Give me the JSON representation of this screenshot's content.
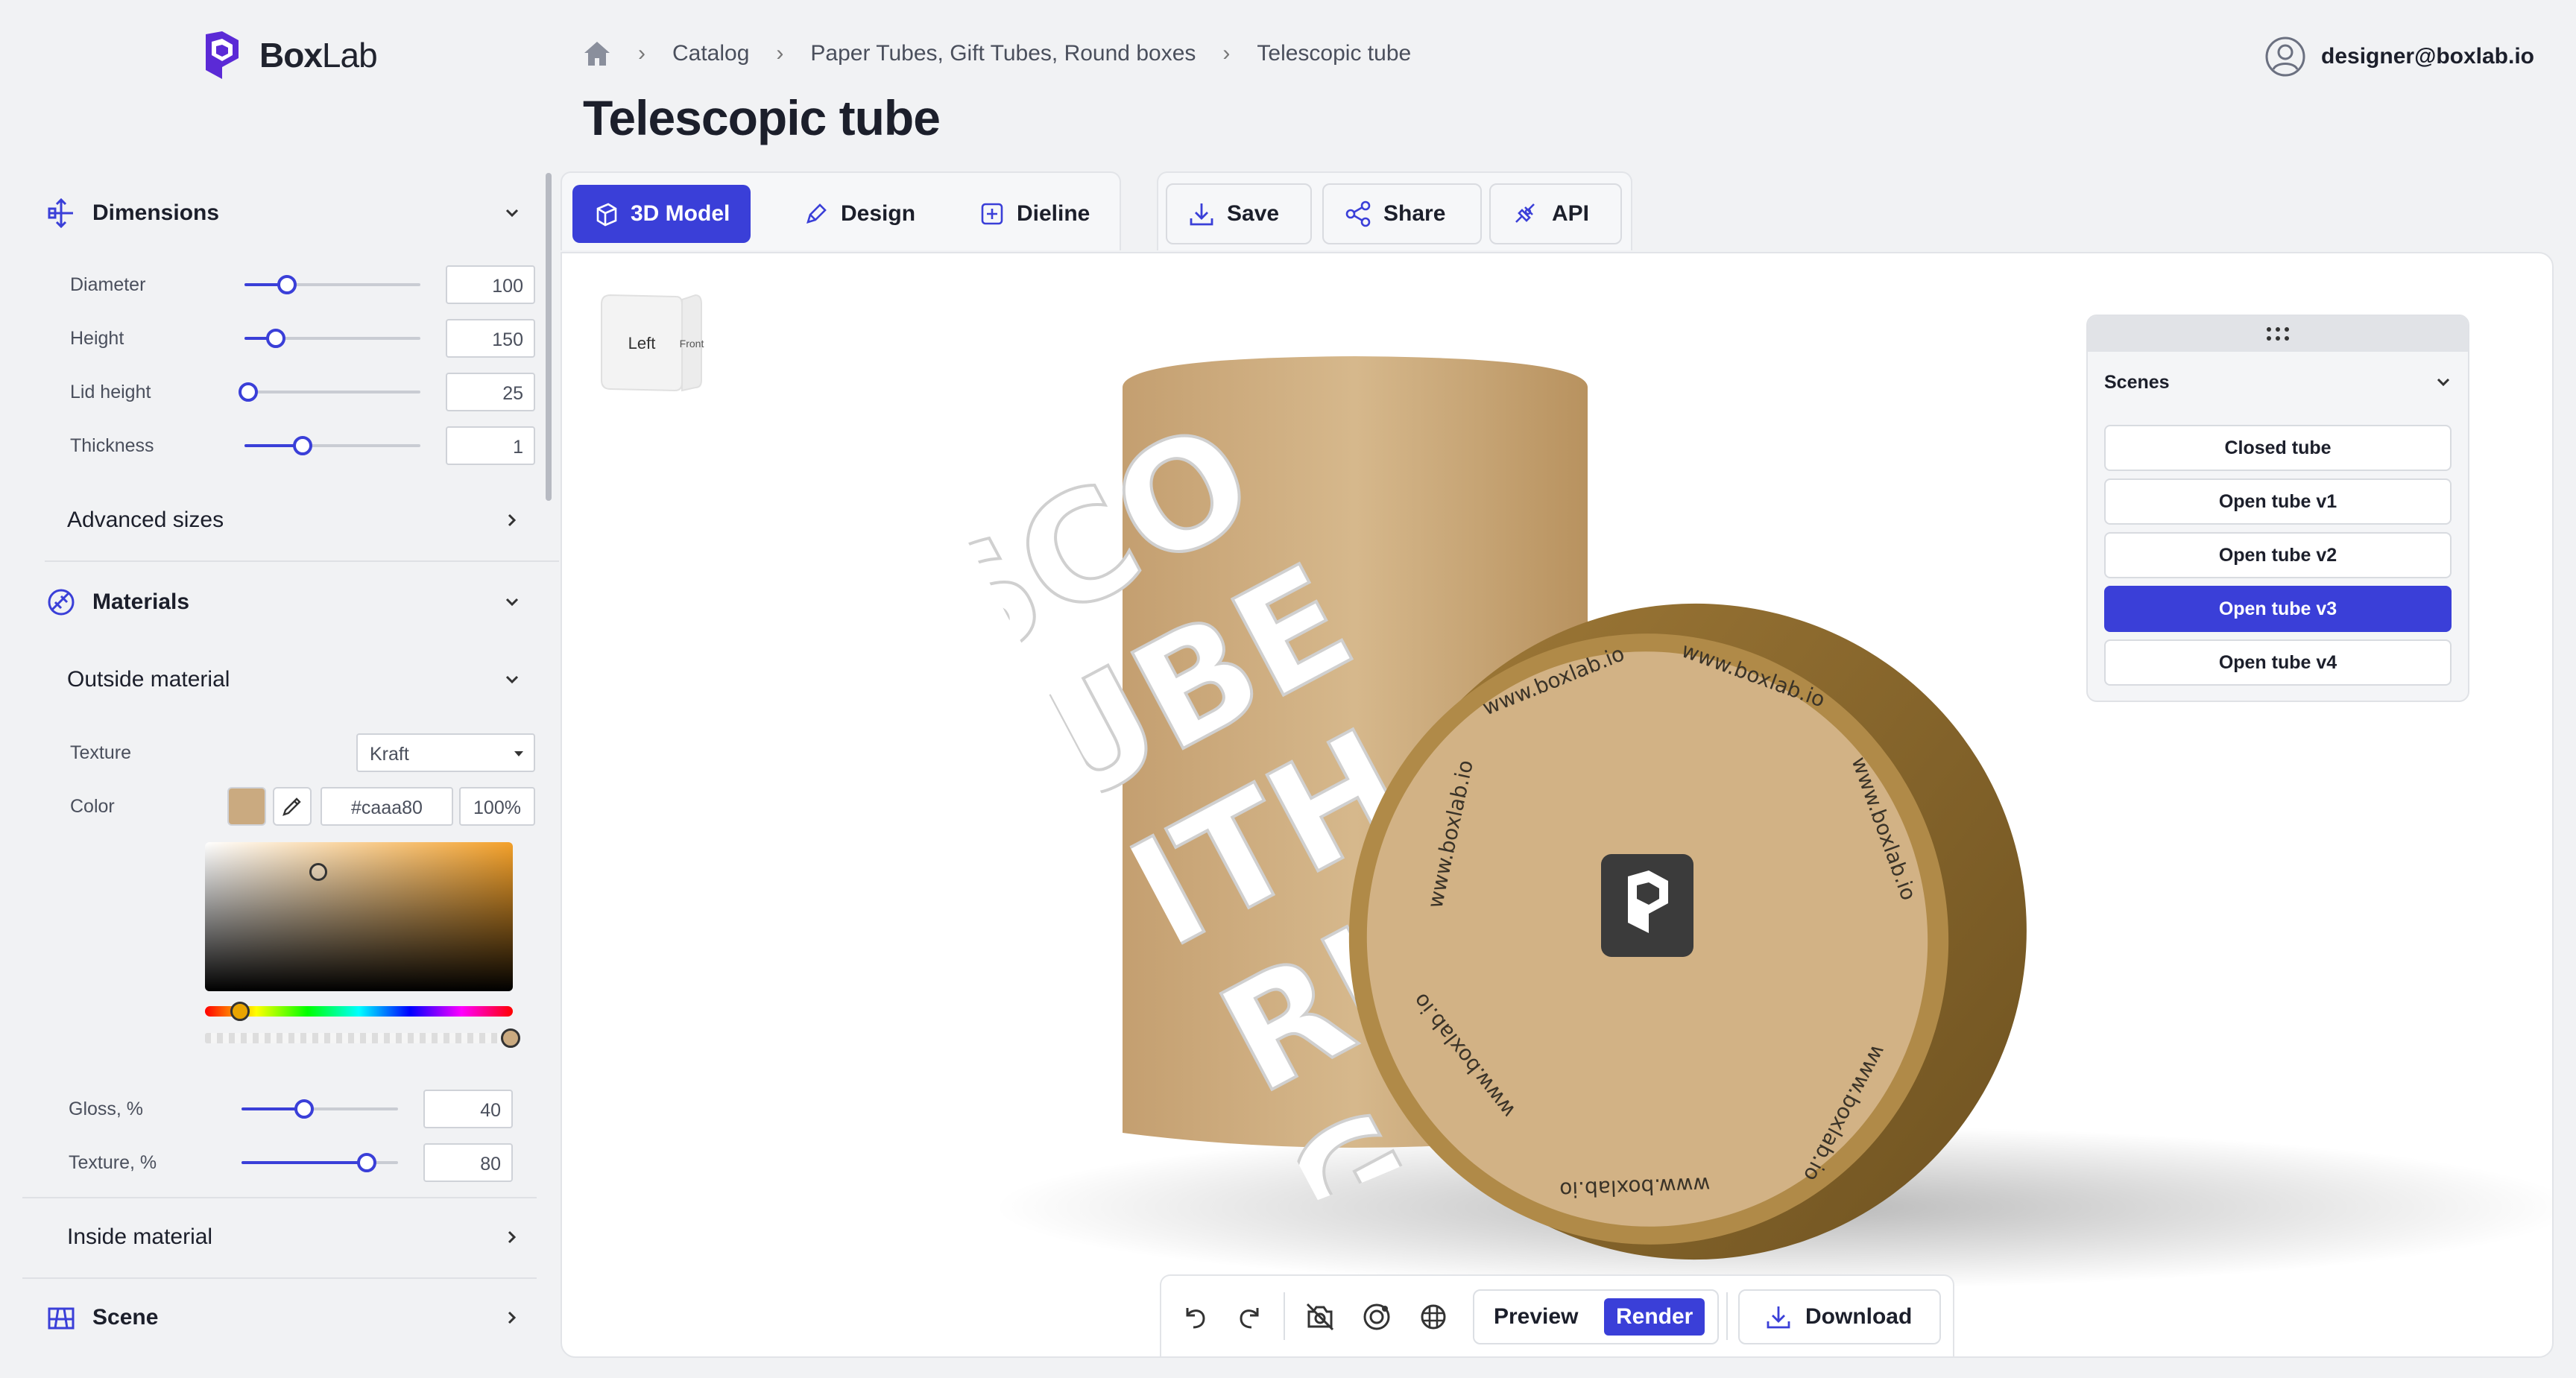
{
  "app": {
    "name_bold": "Box",
    "name_light": "Lab"
  },
  "breadcrumb": [
    "Catalog",
    "Paper Tubes, Gift Tubes, Round boxes",
    "Telescopic tube"
  ],
  "user": {
    "email": "designer@boxlab.io"
  },
  "page_title": "Telescopic tube",
  "sidebar": {
    "dimensions": {
      "label": "Dimensions",
      "fields": [
        {
          "label": "Diameter",
          "value": "100",
          "level": 0.24
        },
        {
          "label": "Height",
          "value": "150",
          "level": 0.18
        },
        {
          "label": "Lid height",
          "value": "25",
          "level": 0.02
        },
        {
          "label": "Thickness",
          "value": "1",
          "level": 0.33
        }
      ],
      "advanced_label": "Advanced sizes"
    },
    "materials": {
      "label": "Materials",
      "outside_label": "Outside material",
      "texture_label": "Texture",
      "texture_value": "Kraft",
      "color_label": "Color",
      "color_hex": "#caaa80",
      "color_opacity": "100%",
      "gloss": {
        "label": "Gloss, %",
        "value": "40",
        "level": 0.4
      },
      "texture_pct": {
        "label": "Texture, %",
        "value": "80",
        "level": 0.8
      },
      "inside_label": "Inside material"
    },
    "scene_label": "Scene"
  },
  "tabs": [
    {
      "label": "3D Model",
      "active": true
    },
    {
      "label": "Design",
      "active": false
    },
    {
      "label": "Dieline",
      "active": false
    }
  ],
  "actions": {
    "save": "Save",
    "share": "Share",
    "api": "API"
  },
  "view_cube": {
    "left": "Left",
    "front": "Front"
  },
  "scenes": {
    "title": "Scenes",
    "items": [
      "Closed tube",
      "Open tube v1",
      "Open tube v2",
      "Open tube v3",
      "Open tube v4"
    ],
    "active_index": 3
  },
  "product": {
    "tube_text_lines": [
      "SCO",
      "TUBE",
      "WITH",
      "CURL",
      "EDG"
    ],
    "lid_url": "www.boxlab.io"
  },
  "toolbar": {
    "preview": "Preview",
    "render": "Render",
    "download": "Download"
  },
  "colors": {
    "accent": "#3a3fd8",
    "kraft": "#caaa80",
    "lid_rim": "#8c6a2e"
  }
}
